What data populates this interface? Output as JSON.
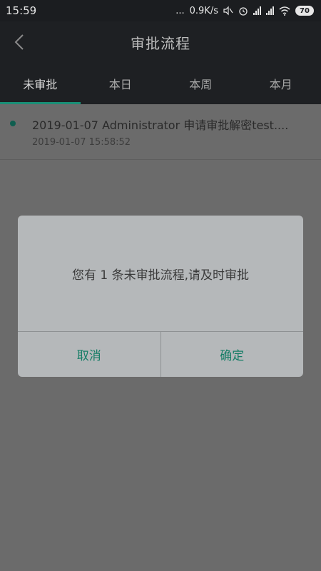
{
  "status_bar": {
    "time": "15:59",
    "dots": "...",
    "speed": "0.9K/s",
    "battery": "70",
    "icons": [
      "mute-icon",
      "alarm-icon",
      "signal-icon",
      "signal-icon",
      "wifi-icon",
      "battery-icon"
    ]
  },
  "header": {
    "title": "审批流程",
    "back_icon": "chevron-left-icon"
  },
  "tabs": [
    {
      "label": "未审批",
      "active": true
    },
    {
      "label": "本日",
      "active": false
    },
    {
      "label": "本周",
      "active": false
    },
    {
      "label": "本月",
      "active": false
    }
  ],
  "list": [
    {
      "title": "2019-01-07 Administrator 申请审批解密test....",
      "time": "2019-01-07 15:58:52"
    }
  ],
  "dialog": {
    "message": "您有 1 条未审批流程,请及时审批",
    "cancel_label": "取消",
    "confirm_label": "确定"
  },
  "colors": {
    "accent": "#1a8f76",
    "dark_bar": "#1e2023",
    "overlay_bg": "#6b6b6b",
    "dialog_bg": "#b5b8ba"
  }
}
